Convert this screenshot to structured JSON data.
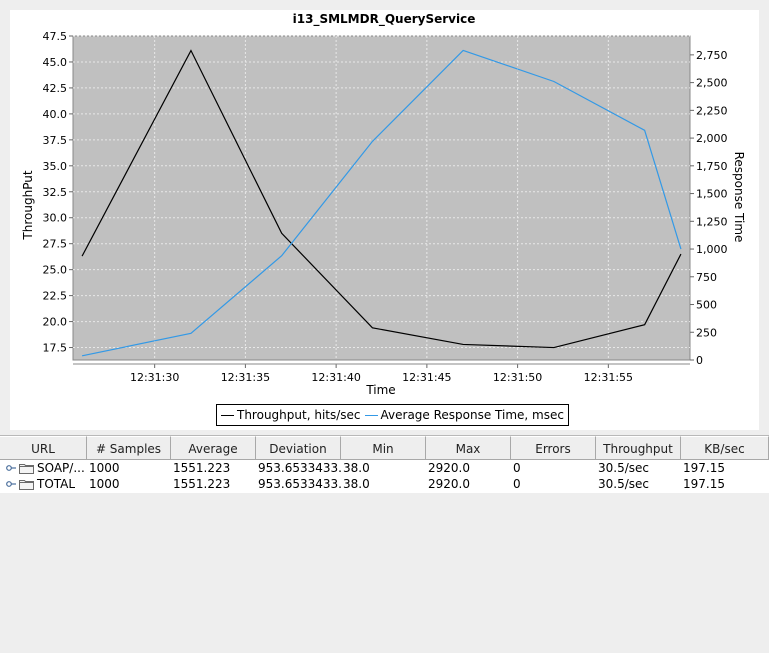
{
  "chart_data": {
    "type": "line",
    "title": "i13_SMLMDR_QueryService",
    "xlabel": "Time",
    "ylabel": "ThroughPut",
    "y2label": "Response Time",
    "x_ticks": [
      "12:31:30",
      "12:31:35",
      "12:31:40",
      "12:31:45",
      "12:31:50",
      "12:31:55"
    ],
    "x_tick_seconds": [
      30,
      35,
      40,
      45,
      50,
      55
    ],
    "xlim": [
      "12:31:25.5",
      "12:31:59.5"
    ],
    "ylim": [
      16.3,
      47.5
    ],
    "y_ticks": [
      "17.5",
      "20.0",
      "22.5",
      "25.0",
      "27.5",
      "30.0",
      "32.5",
      "35.0",
      "37.5",
      "40.0",
      "42.5",
      "45.0",
      "47.5"
    ],
    "y2lim": [
      0,
      2920
    ],
    "y2_ticks": [
      "0",
      "250",
      "500",
      "750",
      "1,000",
      "1,250",
      "1,500",
      "1,750",
      "2,000",
      "2,250",
      "2,500",
      "2,750"
    ],
    "grid": true,
    "legend_position": "bottom",
    "series": [
      {
        "name": "Throughput, hits/sec",
        "axis": "left",
        "color": "#000000",
        "x": [
          "12:31:26",
          "12:31:32",
          "12:31:37",
          "12:31:42",
          "12:31:47",
          "12:31:52",
          "12:31:57",
          "12:31:59"
        ],
        "y": [
          26.3,
          46.1,
          28.5,
          19.4,
          17.8,
          17.5,
          19.7,
          26.5
        ]
      },
      {
        "name": "Average Response Time, msec",
        "axis": "right",
        "color": "#3399e6",
        "x": [
          "12:31:26",
          "12:31:32",
          "12:31:37",
          "12:31:42",
          "12:31:47",
          "12:31:52",
          "12:31:57",
          "12:31:59"
        ],
        "y": [
          38,
          240,
          940,
          1970,
          2790,
          2510,
          2070,
          1000
        ]
      }
    ]
  },
  "table": {
    "columns": [
      "URL",
      "# Samples",
      "Average",
      "Deviation",
      "Min",
      "Max",
      "Errors",
      "Throughput",
      "KB/sec"
    ],
    "rows": [
      [
        "SOAP/...",
        "1000",
        "1551.223",
        "953.6533433...",
        "38.0",
        "2920.0",
        "0",
        "30.5/sec",
        "197.15"
      ],
      [
        "TOTAL",
        "1000",
        "1551.223",
        "953.6533433...",
        "38.0",
        "2920.0",
        "0",
        "30.5/sec",
        "197.15"
      ]
    ]
  }
}
